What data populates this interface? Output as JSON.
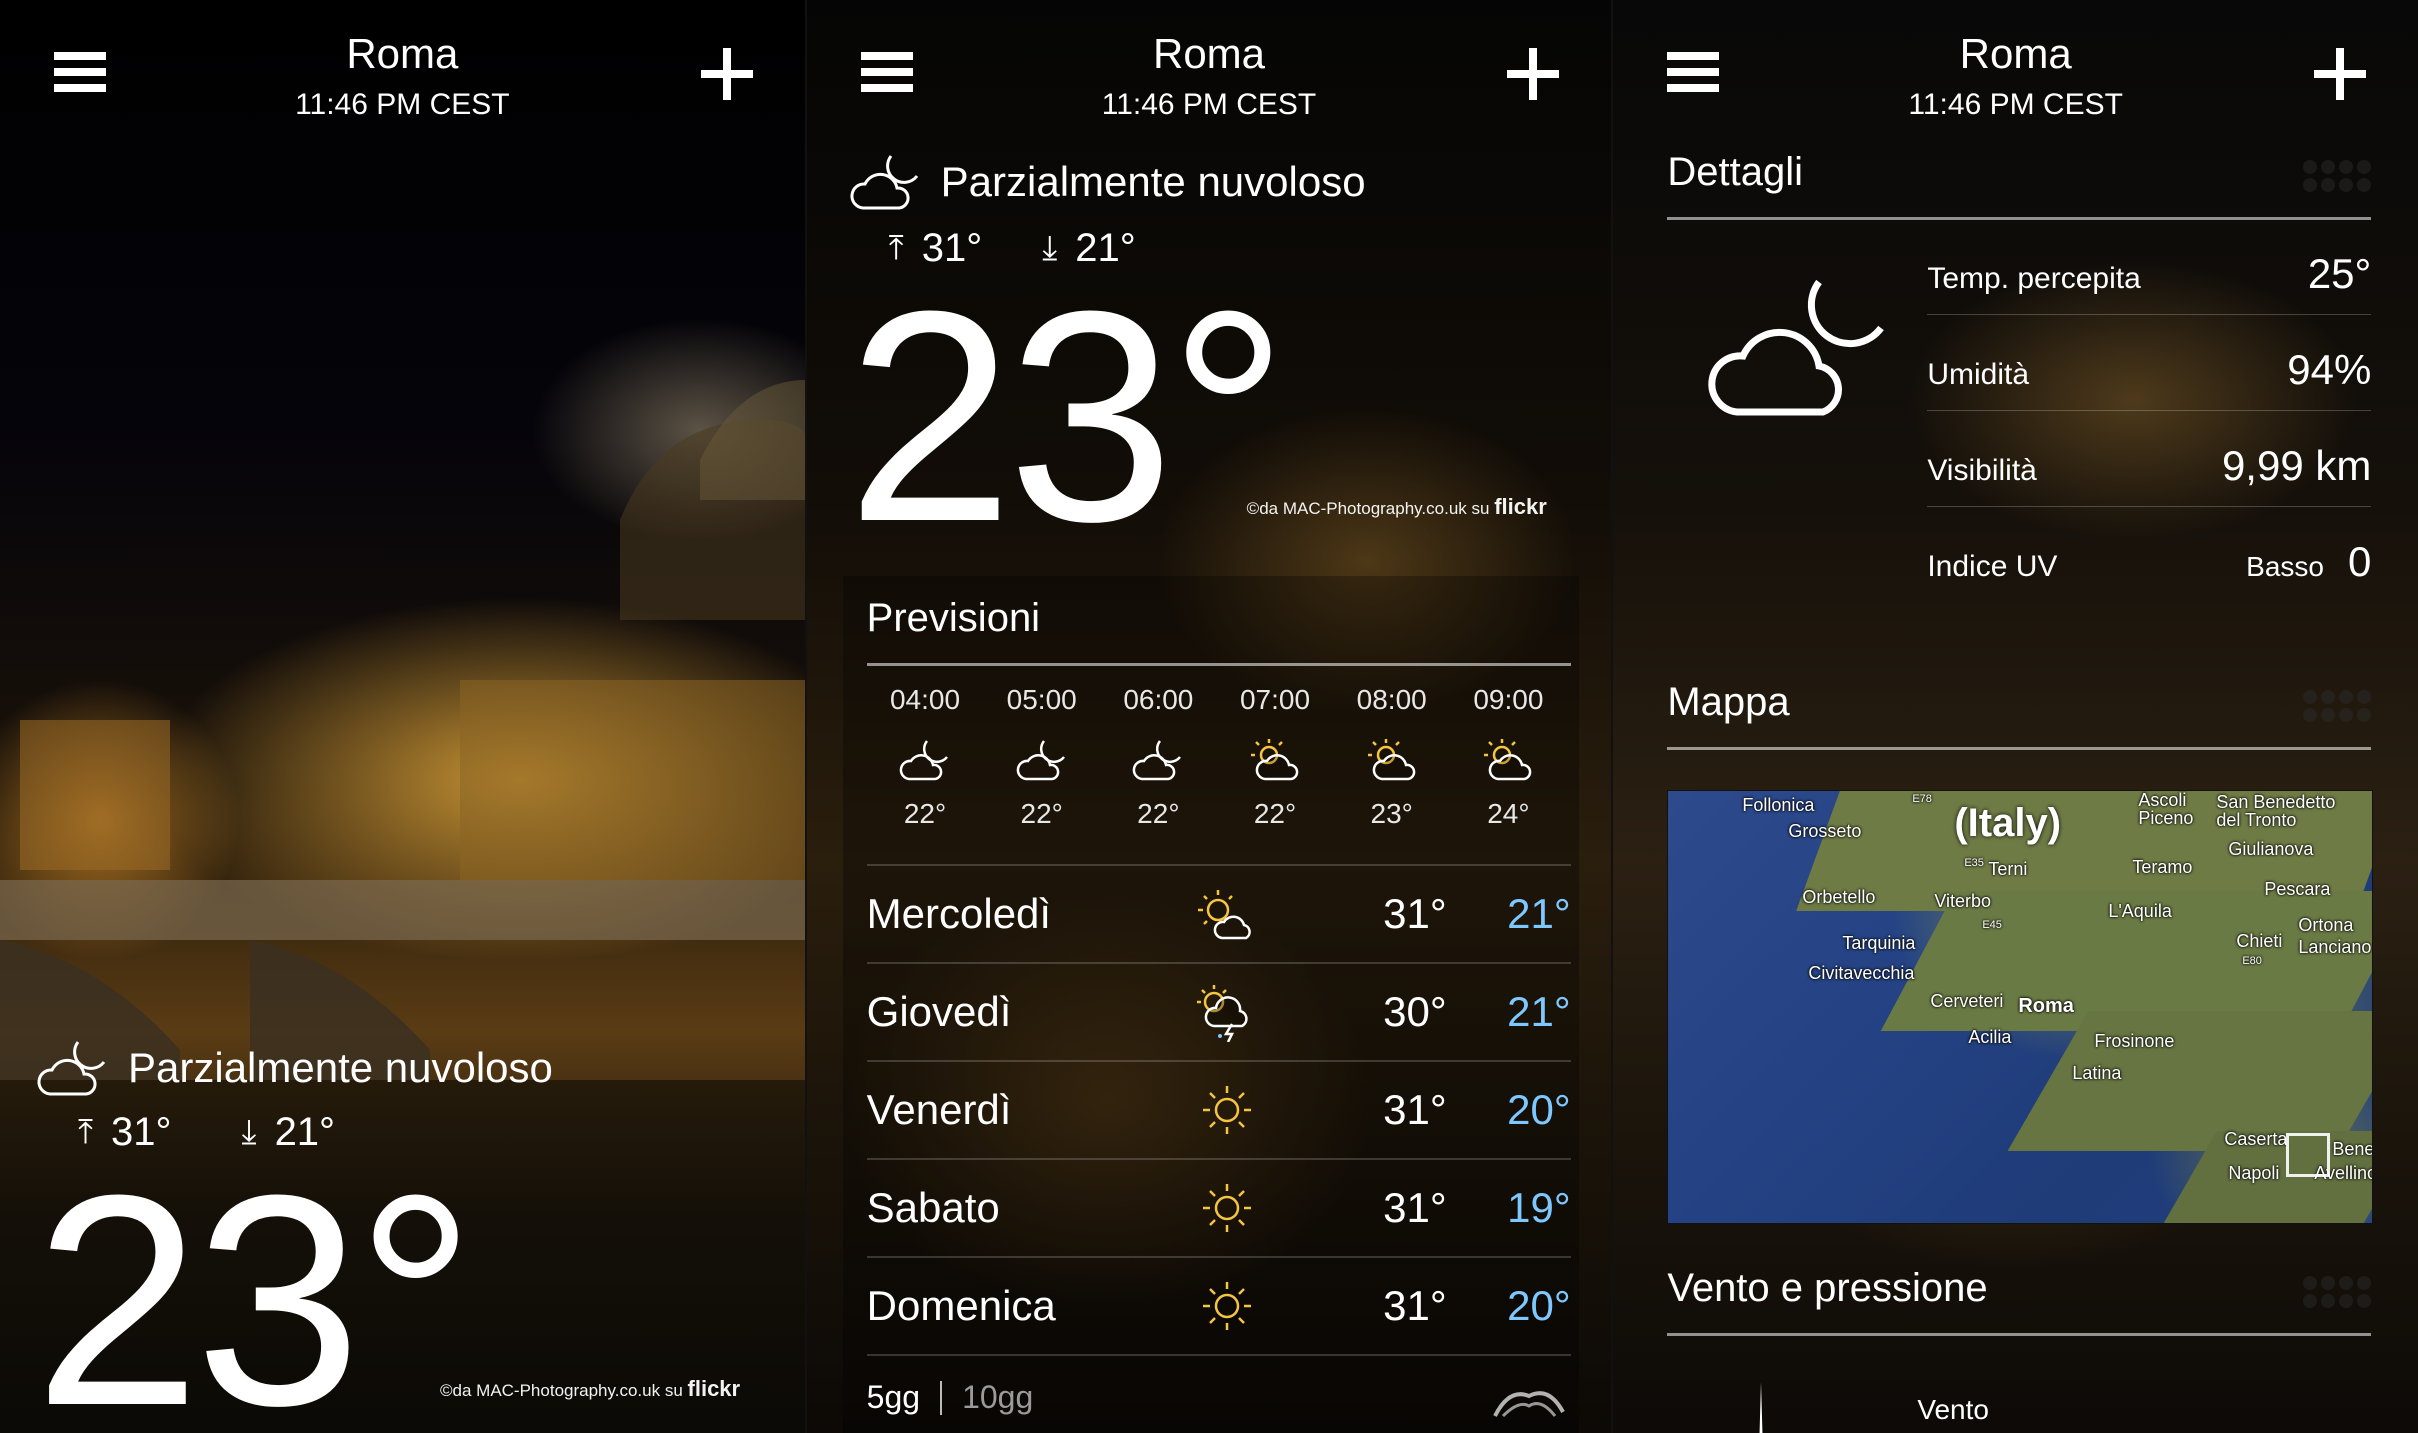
{
  "header": {
    "city": "Roma",
    "time": "11:46 PM CEST"
  },
  "current": {
    "condition": "Parzialmente nuvoloso",
    "high": "31°",
    "low": "21°",
    "temp": "23°",
    "credit_prefix": "©da MAC-Photography.co.uk su",
    "credit_brand": "flickr",
    "arrow_up": "⤒",
    "arrow_down": "⤓"
  },
  "forecast": {
    "title": "Previsioni",
    "hourly": [
      {
        "time": "04:00",
        "icon": "moon-icon",
        "temp": "22°"
      },
      {
        "time": "05:00",
        "icon": "moon-icon",
        "temp": "22°"
      },
      {
        "time": "06:00",
        "icon": "moon-icon",
        "temp": "22°"
      },
      {
        "time": "07:00",
        "icon": "sun-cloud-icon",
        "temp": "22°"
      },
      {
        "time": "08:00",
        "icon": "sun-cloud-icon",
        "temp": "23°"
      },
      {
        "time": "09:00",
        "icon": "sun-cloud-icon",
        "temp": "24°"
      }
    ],
    "daily": [
      {
        "name": "Mercoledì",
        "icon": "partly-sunny-icon",
        "hi": "31°",
        "lo": "21°"
      },
      {
        "name": "Giovedì",
        "icon": "thunderstorm-icon",
        "hi": "30°",
        "lo": "21°"
      },
      {
        "name": "Venerdì",
        "icon": "sun-icon",
        "hi": "31°",
        "lo": "20°"
      },
      {
        "name": "Sabato",
        "icon": "sun-icon",
        "hi": "31°",
        "lo": "19°"
      },
      {
        "name": "Domenica",
        "icon": "sun-icon",
        "hi": "31°",
        "lo": "20°"
      }
    ],
    "tab_5": "5gg",
    "tab_10": "10gg"
  },
  "details": {
    "title": "Dettagli",
    "feels_like_label": "Temp. percepita",
    "feels_like": "25°",
    "humidity_label": "Umidità",
    "humidity": "94%",
    "visibility_label": "Visibilità",
    "visibility": "9,99 km",
    "uv_label": "Indice UV",
    "uv_desc": "Basso",
    "uv_value": "0"
  },
  "map": {
    "title": "Mappa",
    "labels": [
      "Follonica",
      "Grosseto",
      "(Italy)",
      "Ascoli Piceno",
      "San Benedetto del Tronto",
      "Terni",
      "Teramo",
      "Giulianova",
      "Orbetello",
      "Viterbo",
      "L'Aquila",
      "Pescara",
      "Tarquinia",
      "Chieti",
      "Ortona",
      "Lanciano",
      "Civitavecchia",
      "Cerveteri",
      "Roma",
      "Frosinone",
      "Acilia",
      "Latina",
      "Caserta",
      "Napoli",
      "Bene",
      "Avellino",
      "E78",
      "E35",
      "E45",
      "E80"
    ]
  },
  "wind": {
    "title": "Vento e pressione",
    "label": "Vento"
  },
  "colors": {
    "low_temp": "#7ec8ff",
    "sun": "#f5c542"
  }
}
